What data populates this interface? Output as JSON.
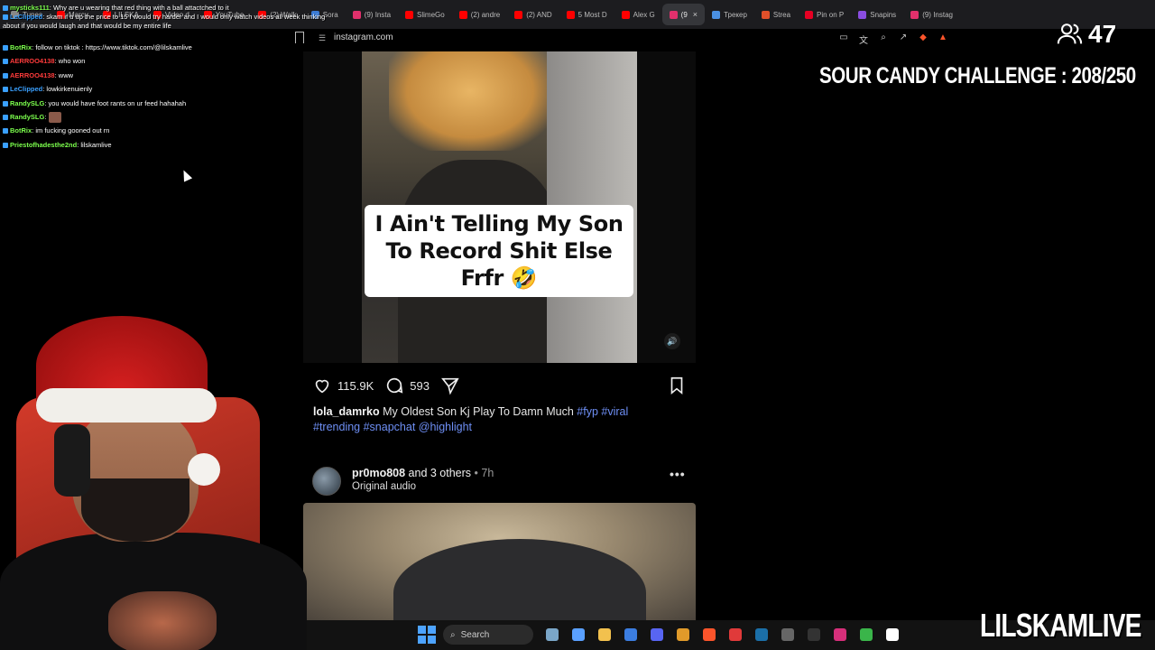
{
  "tabs": [
    {
      "label": "Tunes",
      "icon": "generic-tab-icon",
      "color": "#888888"
    },
    {
      "label": "Marcy",
      "icon": "youtube-icon",
      "color": "#ff0000"
    },
    {
      "label": "LILSKA",
      "icon": "youtube-icon",
      "color": "#ff0000"
    },
    {
      "label": "Video d",
      "icon": "youtube-icon",
      "color": "#ff0000"
    },
    {
      "label": "YouTube",
      "icon": "youtube-icon",
      "color": "#ff0000"
    },
    {
      "label": "(2) Walk",
      "icon": "youtube-icon",
      "color": "#ff0000"
    },
    {
      "label": "Sora",
      "icon": "sora-icon",
      "color": "#3a7bd5"
    },
    {
      "label": "(9) Insta",
      "icon": "instagram-icon",
      "color": "#e1306c"
    },
    {
      "label": "SlimeGo",
      "icon": "youtube-icon",
      "color": "#ff0000"
    },
    {
      "label": "(2) andre",
      "icon": "youtube-icon",
      "color": "#ff0000"
    },
    {
      "label": "(2) AND",
      "icon": "youtube-icon",
      "color": "#ff0000"
    },
    {
      "label": "5 Most D",
      "icon": "youtube-icon",
      "color": "#ff0000"
    },
    {
      "label": "Alex G",
      "icon": "youtube-icon",
      "color": "#ff0000"
    },
    {
      "label": "(9",
      "icon": "instagram-icon",
      "color": "#e1306c",
      "active": true
    },
    {
      "label": "Трекер",
      "icon": "tracker-icon",
      "color": "#4a90e2"
    },
    {
      "label": "Strea",
      "icon": "stream-icon",
      "color": "#e0502a"
    },
    {
      "label": "Pin on P",
      "icon": "pinterest-icon",
      "color": "#e60023"
    },
    {
      "label": "Snapins",
      "icon": "snapins-icon",
      "color": "#8a4de0"
    },
    {
      "label": "(9) Instag",
      "icon": "instagram-icon",
      "color": "#e1306c"
    }
  ],
  "address": {
    "url": "instagram.com"
  },
  "viewers": {
    "count": "47"
  },
  "chat_top": [
    {
      "user": "mysticks111",
      "text": ": Why are u wearing that red thing with a ball attactched to it",
      "color": "#7cff4d"
    },
    {
      "user": "LeClipped",
      "text": ": skam if u up the price to 15 I would try harder and I would only watch videos all week thinking",
      "color": "#3aa0ff"
    },
    {
      "user": "",
      "text": "about if you would laugh and that would be my entire life",
      "color": "#ffffff"
    }
  ],
  "chat": [
    {
      "user": "BotRix",
      "text": ": follow on tiktok : https://www.tiktok.com/@lilskamlive",
      "color": "#7cff4d"
    },
    {
      "user": "AERROO4138",
      "text": ": who won",
      "color": "#ff3b3b"
    },
    {
      "user": "AERROO4138",
      "text": ": www",
      "color": "#ff3b3b"
    },
    {
      "user": "LeClipped",
      "text": ": lowkirkenuienly",
      "color": "#3aa0ff"
    },
    {
      "user": "RandySLG",
      "text": ": you would have foot rants on ur feed hahahah",
      "color": "#7cff4d"
    },
    {
      "user": "RandySLG",
      "text": ":",
      "color": "#7cff4d",
      "emote": true
    },
    {
      "user": "BotRix",
      "text": ": im fucking gooned out rn",
      "color": "#7cff4d"
    },
    {
      "user": "Priestofhadesthe2nd",
      "text": ": lilskamlive",
      "color": "#7cff4d"
    }
  ],
  "challenge": {
    "text": "SOUR CANDY CHALLENGE : 208/250"
  },
  "post": {
    "caption_overlay": "I Ain't Telling My Son To Record Shit Else Frfr 🤣",
    "likes": "115.9K",
    "comments": "593",
    "author": "lola_damrko",
    "caption": "My Oldest Son Kj Play To Damn Much",
    "hashtags": [
      "#fyp",
      "#viral",
      "#trending",
      "#snapchat",
      "@highlight"
    ]
  },
  "next_post": {
    "user": "pr0mo808",
    "coauthors": "and 3 others",
    "time": "• 7h",
    "audio": "Original audio",
    "more": "•••"
  },
  "taskbar": {
    "search_label": "Search",
    "apps": [
      {
        "name": "widgets-icon",
        "color": "#7aa6c8"
      },
      {
        "name": "copilot-icon",
        "color": "#5aa0ff"
      },
      {
        "name": "file-explorer-icon",
        "color": "#f2c14e"
      },
      {
        "name": "store-icon",
        "color": "#3b7de0"
      },
      {
        "name": "discord-icon",
        "color": "#5865f2"
      },
      {
        "name": "shield-app-icon",
        "color": "#e09a2a"
      },
      {
        "name": "brave-icon",
        "color": "#fb542b"
      },
      {
        "name": "opera-gx-icon",
        "color": "#e03a3a"
      },
      {
        "name": "steam-icon",
        "color": "#1b6fa8"
      },
      {
        "name": "keyboard-app-icon",
        "color": "#666666"
      },
      {
        "name": "k-app-icon",
        "color": "#333333"
      },
      {
        "name": "instagram-icon",
        "color": "#d62f7a"
      },
      {
        "name": "colorful-app-icon",
        "color": "#3ab54a"
      },
      {
        "name": "capcut-icon",
        "color": "#ffffff"
      }
    ]
  },
  "brand": {
    "text": "LILSKAMLIVE"
  }
}
